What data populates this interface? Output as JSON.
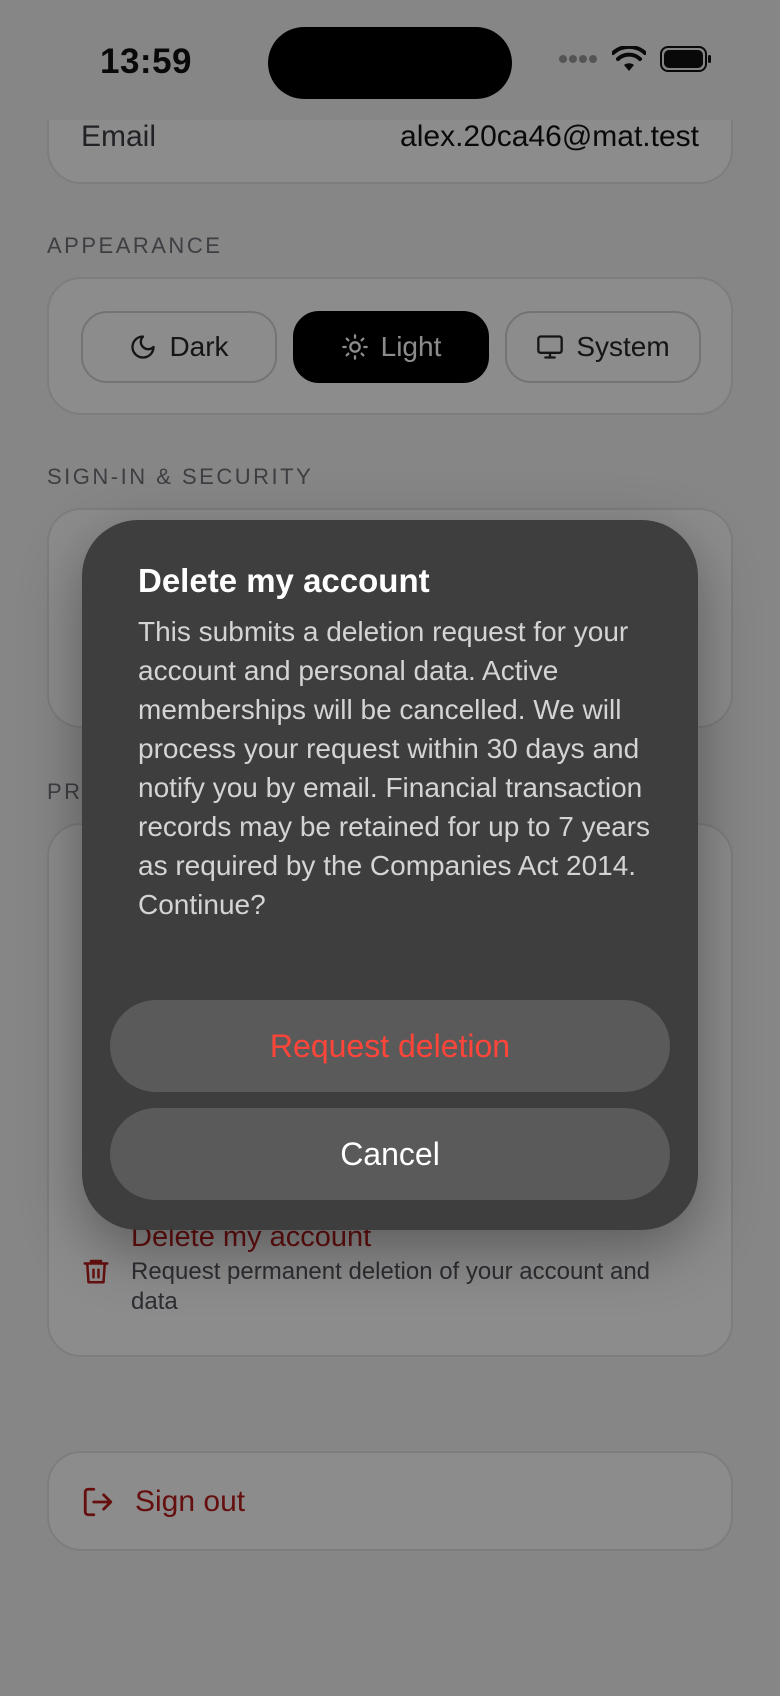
{
  "status_bar": {
    "time": "13:59"
  },
  "account": {
    "email_label": "Email",
    "email_value": "alex.20ca46@mat.test"
  },
  "appearance": {
    "section_label": "APPEARANCE",
    "options": [
      {
        "label": "Dark",
        "icon": "moon-icon"
      },
      {
        "label": "Light",
        "icon": "sun-icon",
        "selected": true
      },
      {
        "label": "System",
        "icon": "monitor-icon"
      }
    ]
  },
  "security": {
    "section_label": "SIGN-IN & SECURITY"
  },
  "privacy": {
    "section_label_partial": "PR",
    "delete_account": {
      "title": "Delete my account",
      "subtitle": "Request permanent deletion of your account and data",
      "icon": "trash-icon"
    }
  },
  "sign_out": {
    "label": "Sign out",
    "icon": "sign-out-icon"
  },
  "dialog": {
    "title": "Delete my account",
    "message": "This submits a deletion request for your account and personal data. Active memberships will be cancelled. We will process your request within 30 days and notify you by email. Financial transaction records may be retained for up to 7 years as required by the Companies Act 2014. Continue?",
    "confirm_label": "Request deletion",
    "cancel_label": "Cancel"
  },
  "colors": {
    "destructive": "#ff453a",
    "danger_text": "#b91c1c",
    "scrim": "#000000"
  }
}
